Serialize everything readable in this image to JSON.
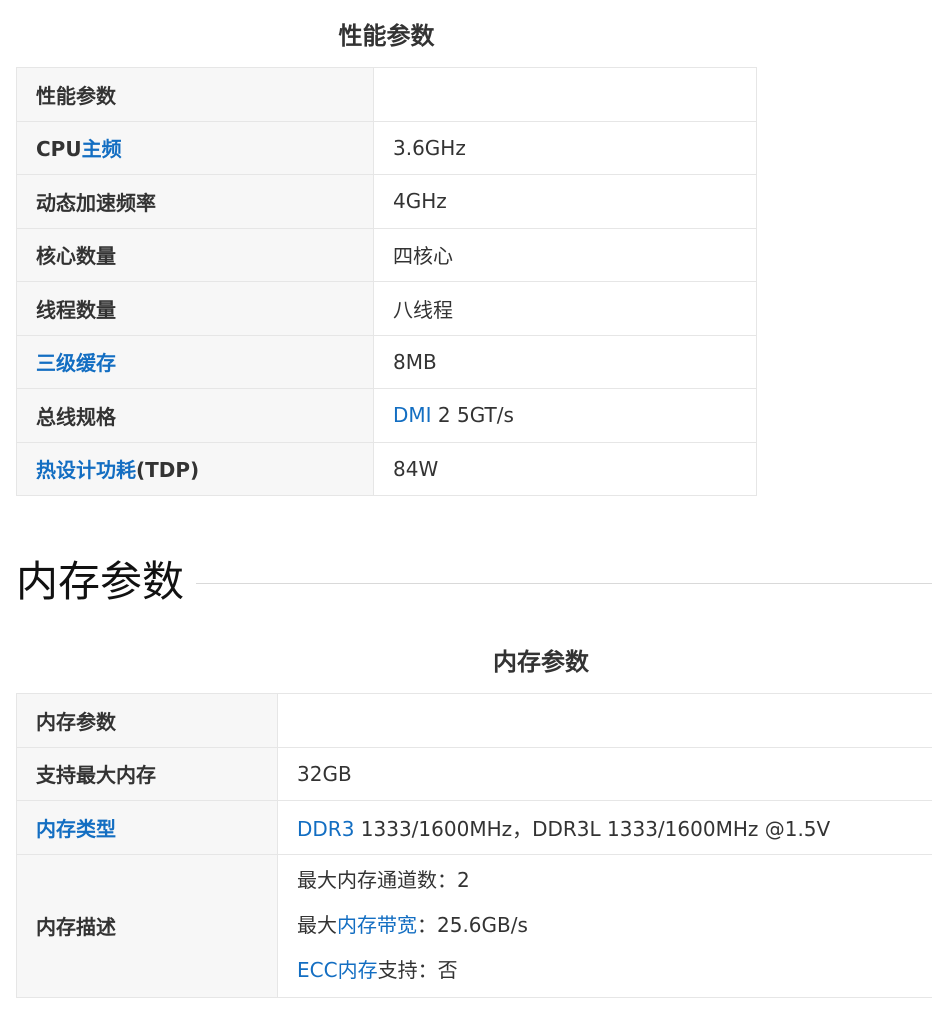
{
  "perf": {
    "caption": "性能参数",
    "header_label": "性能参数",
    "rows": [
      {
        "key_plain": "CPU",
        "key_link": "主频",
        "value": "3.6GHz"
      },
      {
        "key": "动态加速频率",
        "value": "4GHz"
      },
      {
        "key": "核心数量",
        "value": "四核心"
      },
      {
        "key": "线程数量",
        "value": "八线程"
      },
      {
        "key_link": "三级缓存",
        "value": "8MB"
      },
      {
        "key": "总线规格",
        "value_link": "DMI",
        "value": " 2 5GT/s"
      },
      {
        "key_link": "热设计功耗",
        "key_plain": "(TDP)",
        "value": "84W"
      }
    ]
  },
  "memory_section": {
    "title": "内存参数"
  },
  "memory": {
    "caption": "内存参数",
    "header_label": "内存参数",
    "max_memory": {
      "key": "支持最大内存",
      "value": "32GB"
    },
    "memory_type": {
      "key_link": "内存类型",
      "value_link": "DDR3",
      "value": " 1333/1600MHz，DDR3L 1333/1600MHz @1.5V"
    },
    "description": {
      "key": "内存描述",
      "line1": "最大内存通道数：2",
      "line2_prefix": "最大",
      "line2_link": "内存带宽",
      "line2_suffix": "：25.6GB/s",
      "line3_link": "ECC内存",
      "line3_suffix": "支持：否"
    }
  },
  "colors": {
    "link": "#136ec2",
    "key_bg": "#f7f7f7",
    "border": "#e6e6e6"
  }
}
